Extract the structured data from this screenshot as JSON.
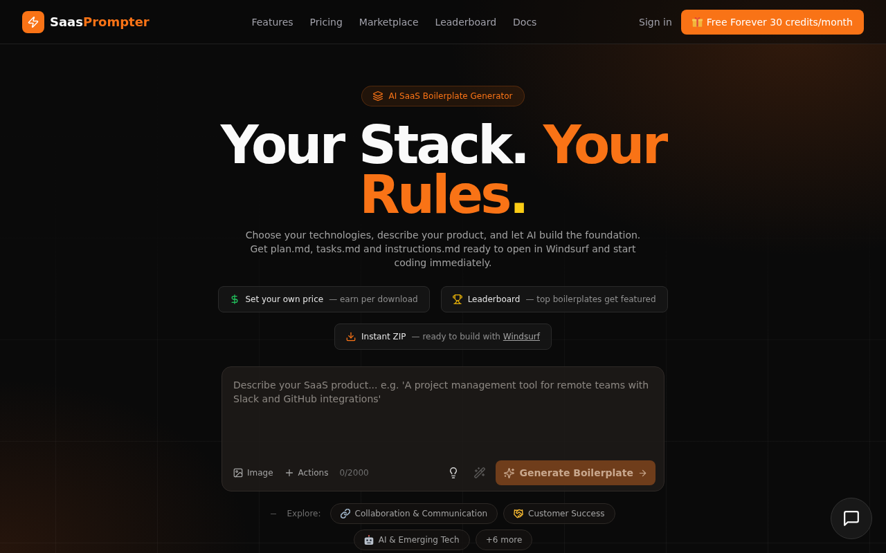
{
  "nav": {
    "brand": {
      "lead": "Saas",
      "accent": "Prompter"
    },
    "links": [
      {
        "label": "Features"
      },
      {
        "label": "Pricing"
      },
      {
        "label": "Marketplace"
      },
      {
        "label": "Leaderboard"
      },
      {
        "label": "Docs"
      }
    ],
    "sign_in": "Sign in",
    "cta": "Free Forever 30 credits/month"
  },
  "hero": {
    "badge": "AI SaaS Boilerplate Generator",
    "headline": {
      "lead": "Your Stack.",
      "accent": "Your Rules",
      "end": "."
    },
    "subtitle": "Choose your technologies, describe your product, and let AI build the foundation. Get plan.md, tasks.md and instructions.md ready to open in Windsurf and start coding immediately."
  },
  "features": [
    {
      "kind": "price",
      "title": "Set your own price",
      "description": "— earn per download"
    },
    {
      "kind": "leaderboard",
      "title": "Leaderboard",
      "description": "— top boilerplates get featured"
    },
    {
      "kind": "zip",
      "title": "Instant ZIP",
      "description": "— ready to build with",
      "link": "Windsurf"
    }
  ],
  "prompt": {
    "placeholder": "Describe your SaaS product... e.g. 'A project management tool for remote teams with Slack and GitHub integrations'",
    "image_button": "Image",
    "actions_button": "Actions",
    "counter": "0/2000",
    "tools": [
      {
        "kind": "idea",
        "disabled": false
      },
      {
        "kind": "enhance",
        "disabled": true
      }
    ],
    "generate": {
      "label": "Generate Boilerplate",
      "disabled": true
    }
  },
  "explore": {
    "label": "Explore:",
    "chips": [
      {
        "kind": "link",
        "label": "Collaboration & Communication"
      },
      {
        "kind": "handshake",
        "label": "Customer Success"
      },
      {
        "kind": "robot",
        "label": "AI & Emerging Tech"
      },
      {
        "kind": "more",
        "label": "+6 more"
      }
    ]
  }
}
